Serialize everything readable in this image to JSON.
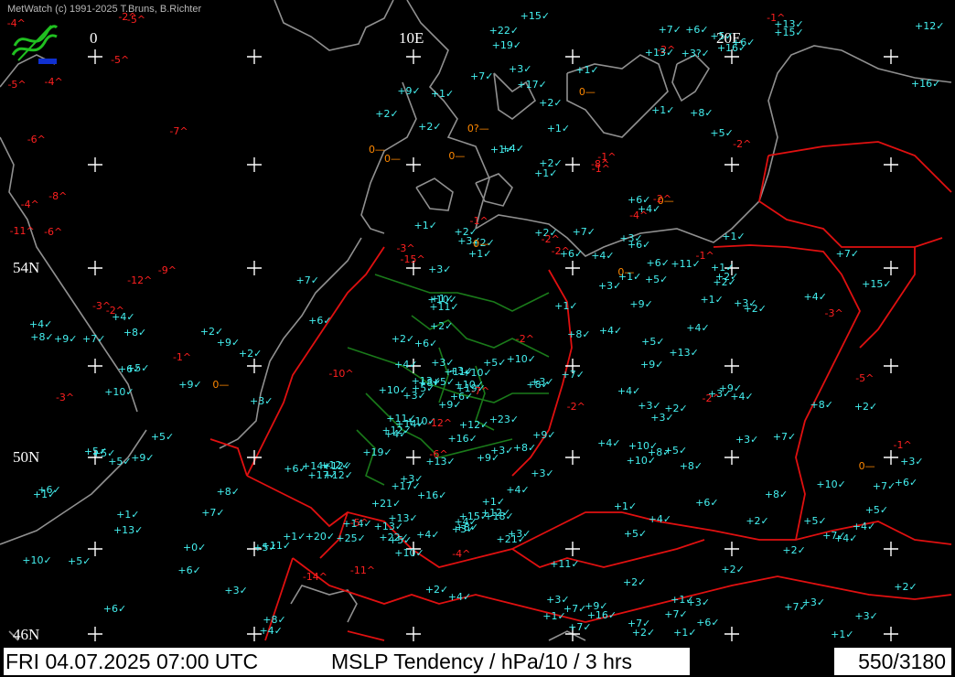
{
  "copyright": "MetWatch (c) 1991-2025 T.Bruns, B.Richter",
  "footer": {
    "datetime": "FRI 04.07.2025 07:00 UTC",
    "product": "MSLP Tendency / hPa/10 / 3 hrs",
    "frame": "550/3180"
  },
  "grid_labels": [
    "0",
    "10E",
    "20E",
    "54N",
    "50N",
    "46N"
  ],
  "colors": {
    "rising": "#44f0f0",
    "falling": "#ff2020",
    "neutral": "#ff8800",
    "coast": "#909090",
    "border": "#e01010",
    "german_states": "#1a7a1a",
    "grid": "#ffffff"
  },
  "stations": [
    [
      "+3?",
      "c"
    ],
    [
      "+22",
      "c"
    ],
    [
      "-2",
      "r"
    ],
    [
      "+7",
      "c"
    ],
    [
      "+6",
      "c"
    ],
    [
      "+1",
      "c"
    ],
    [
      "-1",
      "r"
    ],
    [
      "+6",
      "c"
    ],
    [
      "+13",
      "c"
    ],
    [
      "+16",
      "c"
    ],
    [
      "+15",
      "c"
    ],
    [
      "+16",
      "c"
    ],
    [
      "+19",
      "c"
    ],
    [
      "+12",
      "c"
    ],
    [
      "+13",
      "c"
    ],
    [
      "+15",
      "c"
    ],
    [
      "+17",
      "c"
    ],
    [
      "+7",
      "c"
    ],
    [
      "+5",
      "c"
    ],
    [
      "+3",
      "c"
    ],
    [
      "+4",
      "c"
    ],
    [
      "-3",
      "r"
    ],
    [
      "+3",
      "c"
    ],
    [
      "+1",
      "c"
    ],
    [
      "-1",
      "r"
    ],
    [
      "0",
      "o"
    ],
    [
      "+2",
      "c"
    ],
    [
      "+2",
      "c"
    ],
    [
      "0",
      "o"
    ],
    [
      "+6",
      "c"
    ],
    [
      "-2",
      "r"
    ],
    [
      "+1",
      "c"
    ],
    [
      "+2",
      "c"
    ],
    [
      "+2",
      "c"
    ],
    [
      "0?",
      "o"
    ],
    [
      "+1",
      "c"
    ],
    [
      "-1",
      "r"
    ],
    [
      "-1",
      "r"
    ],
    [
      "+1",
      "c"
    ],
    [
      "-2",
      "r"
    ],
    [
      "0",
      "o"
    ],
    [
      "+1",
      "c"
    ],
    [
      "0",
      "o"
    ],
    [
      "-4",
      "r"
    ],
    [
      "+1",
      "c"
    ],
    [
      "0",
      "o"
    ],
    [
      "-8",
      "r"
    ],
    [
      "-15",
      "r"
    ],
    [
      "-2",
      "r"
    ],
    [
      "-1",
      "r"
    ],
    [
      "+1",
      "c"
    ],
    [
      "+5",
      "c"
    ],
    [
      "+2",
      "c"
    ],
    [
      "+4",
      "c"
    ],
    [
      "+3",
      "c"
    ],
    [
      "+2",
      "c"
    ],
    [
      "+1",
      "c"
    ],
    [
      "+9",
      "c"
    ],
    [
      "+7",
      "c"
    ],
    [
      "+8",
      "c"
    ],
    [
      "+6",
      "c"
    ],
    [
      "+9",
      "c"
    ],
    [
      "+8",
      "c"
    ],
    [
      "+10",
      "c"
    ],
    [
      "+4",
      "c"
    ],
    [
      "+2",
      "c"
    ],
    [
      "+2",
      "c"
    ],
    [
      "+3",
      "c"
    ],
    [
      "+3",
      "c"
    ],
    [
      "+5",
      "c"
    ],
    [
      "+5",
      "c"
    ],
    [
      "+7",
      "c"
    ],
    [
      "+8",
      "c"
    ],
    [
      "+8",
      "c"
    ],
    [
      "+2",
      "c"
    ],
    [
      "+3",
      "c"
    ],
    [
      "+5",
      "c"
    ],
    [
      "+3",
      "c"
    ],
    [
      "+4",
      "c"
    ],
    [
      "+1",
      "c"
    ],
    [
      "+2",
      "c"
    ],
    [
      "+4",
      "c"
    ],
    [
      "+3",
      "c"
    ],
    [
      "+5",
      "c"
    ],
    [
      "+7",
      "c"
    ],
    [
      "+2",
      "c"
    ],
    [
      "+4",
      "c"
    ],
    [
      "+3",
      "c"
    ],
    [
      "+1",
      "c"
    ],
    [
      "+2",
      "c"
    ],
    [
      "0",
      "o"
    ],
    [
      "+3",
      "c"
    ],
    [
      "+4",
      "c"
    ],
    [
      "+2",
      "c"
    ],
    [
      "+3",
      "c"
    ],
    [
      "+4",
      "c"
    ],
    [
      "+5",
      "c"
    ],
    [
      "+2",
      "c"
    ],
    [
      "+3",
      "c"
    ],
    [
      "+2",
      "c"
    ],
    [
      "+3",
      "c"
    ],
    [
      "-2",
      "r"
    ],
    [
      "-1",
      "r"
    ],
    [
      "+3",
      "c"
    ],
    [
      "+1",
      "c"
    ],
    [
      "+3",
      "c"
    ],
    [
      "+3",
      "c"
    ],
    [
      "-2",
      "r"
    ],
    [
      "-3",
      "r"
    ],
    [
      "-2",
      "r"
    ],
    [
      "0",
      "o"
    ],
    [
      "+11",
      "c"
    ],
    [
      "+5",
      "c"
    ],
    [
      "+4",
      "c"
    ],
    [
      "+6",
      "c"
    ],
    [
      "+4",
      "c"
    ],
    [
      "+10",
      "c"
    ],
    [
      "+15",
      "c"
    ],
    [
      "+4",
      "c"
    ],
    [
      "+4",
      "c"
    ],
    [
      "+3",
      "c"
    ],
    [
      "+7",
      "c"
    ],
    [
      "+13",
      "c"
    ],
    [
      "+8",
      "c"
    ],
    [
      "+7",
      "c"
    ],
    [
      "+4",
      "c"
    ],
    [
      "+3",
      "c"
    ],
    [
      "+16",
      "c"
    ],
    [
      "+8",
      "c"
    ],
    [
      "+2",
      "c"
    ],
    [
      "+8",
      "c"
    ],
    [
      "+6",
      "c"
    ],
    [
      "+3",
      "c"
    ],
    [
      "+1",
      "c"
    ],
    [
      "+7",
      "c"
    ],
    [
      "+5",
      "c"
    ],
    [
      "+3",
      "c"
    ],
    [
      "+4",
      "c"
    ],
    [
      "+6",
      "c"
    ],
    [
      "+7",
      "c"
    ],
    [
      "+8",
      "c"
    ],
    [
      "+6",
      "c"
    ],
    [
      "+7",
      "c"
    ],
    [
      "+5",
      "c"
    ],
    [
      "+3",
      "c"
    ],
    [
      "+1",
      "c"
    ],
    [
      "+9",
      "c"
    ],
    [
      "+7",
      "c"
    ],
    [
      "+2",
      "c"
    ],
    [
      "+1",
      "c"
    ],
    [
      "-5",
      "r"
    ],
    [
      "-2",
      "r"
    ],
    [
      "+13",
      "c"
    ],
    [
      "+7",
      "c"
    ],
    [
      "+10",
      "c"
    ],
    [
      "+11",
      "c"
    ],
    [
      "+9",
      "c"
    ],
    [
      "+9",
      "c"
    ],
    [
      "+8",
      "c"
    ],
    [
      "+4",
      "c"
    ],
    [
      "+6",
      "c"
    ],
    [
      "+5",
      "c"
    ],
    [
      "+4",
      "c"
    ],
    [
      "+6",
      "c"
    ],
    [
      "+2",
      "c"
    ],
    [
      "+3",
      "c"
    ],
    [
      "+1",
      "c"
    ],
    [
      "+2",
      "c"
    ],
    [
      "0",
      "o"
    ],
    [
      "+1",
      "c"
    ],
    [
      "+4",
      "c"
    ],
    [
      "+3",
      "c"
    ],
    [
      "+4",
      "c"
    ],
    [
      "+1",
      "c"
    ],
    [
      "+9",
      "c"
    ],
    [
      "+1",
      "c"
    ],
    [
      "+1",
      "c"
    ],
    [
      "+2",
      "c"
    ],
    [
      "+2",
      "c"
    ],
    [
      "+3",
      "c"
    ],
    [
      "+6",
      "c"
    ],
    [
      "+8",
      "c"
    ],
    [
      "+7",
      "c"
    ],
    [
      "+5",
      "c"
    ],
    [
      "+10",
      "c"
    ],
    [
      "+10",
      "c"
    ],
    [
      "+11",
      "c"
    ],
    [
      "+9",
      "c"
    ],
    [
      "+11",
      "c"
    ],
    [
      "+10",
      "c"
    ],
    [
      "+12",
      "c"
    ],
    [
      "+13",
      "c"
    ],
    [
      "+14",
      "c"
    ],
    [
      "+12",
      "c"
    ],
    [
      "+13",
      "c"
    ],
    [
      "+10",
      "c"
    ],
    [
      "+12",
      "c"
    ],
    [
      "+11",
      "c"
    ],
    [
      "+15",
      "c"
    ],
    [
      "+14",
      "c"
    ],
    [
      "+12",
      "c"
    ],
    [
      "+10",
      "c"
    ],
    [
      "+12",
      "c"
    ],
    [
      "+14",
      "c"
    ],
    [
      "+16",
      "c"
    ],
    [
      "+17",
      "c"
    ],
    [
      "+17",
      "c"
    ],
    [
      "+20",
      "c"
    ],
    [
      "+13",
      "c"
    ],
    [
      "+19",
      "c"
    ],
    [
      "+21",
      "c"
    ],
    [
      "+23",
      "c"
    ],
    [
      "+19",
      "c"
    ],
    [
      "+18",
      "c"
    ],
    [
      "+9",
      "c"
    ],
    [
      "+22",
      "c"
    ],
    [
      "+25",
      "c"
    ],
    [
      "+16",
      "c"
    ],
    [
      "+21",
      "c"
    ],
    [
      "+12",
      "c"
    ],
    [
      "+10",
      "c"
    ],
    [
      "+10",
      "c"
    ],
    [
      "-14",
      "r"
    ],
    [
      "-12",
      "r"
    ],
    [
      "-11",
      "r"
    ],
    [
      "-5",
      "r"
    ],
    [
      "-6",
      "r"
    ],
    [
      "-7",
      "r"
    ],
    [
      "-10",
      "r"
    ],
    [
      "-4",
      "r"
    ],
    [
      "-2",
      "r"
    ],
    [
      "-5",
      "r"
    ],
    [
      "-3",
      "r"
    ],
    [
      "-4",
      "r"
    ],
    [
      "-6",
      "r"
    ],
    [
      "-5",
      "r"
    ],
    [
      "-8",
      "r"
    ],
    [
      "-4",
      "r"
    ],
    [
      "-11",
      "r"
    ],
    [
      "-12",
      "r"
    ],
    [
      "-7",
      "r"
    ],
    [
      "-9",
      "r"
    ],
    [
      "-5",
      "r"
    ],
    [
      "-6",
      "r"
    ],
    [
      "-3",
      "r"
    ],
    [
      "-2",
      "r"
    ],
    [
      "-1",
      "r"
    ],
    [
      "-4",
      "r"
    ],
    [
      "0",
      "o"
    ],
    [
      "+3",
      "c"
    ],
    [
      "+5",
      "c"
    ],
    [
      "+6",
      "c"
    ],
    [
      "+7",
      "c"
    ],
    [
      "+10",
      "c"
    ],
    [
      "+4",
      "c"
    ],
    [
      "+2",
      "c"
    ],
    [
      "+13",
      "c"
    ],
    [
      "+6",
      "c"
    ],
    [
      "+9",
      "c"
    ],
    [
      "+5",
      "c"
    ],
    [
      "+11",
      "c"
    ],
    [
      "+8",
      "c"
    ],
    [
      "+10",
      "c"
    ],
    [
      "+6",
      "c"
    ],
    [
      "+5",
      "c"
    ],
    [
      "+8",
      "c"
    ],
    [
      "+6",
      "c"
    ],
    [
      "+7",
      "c"
    ],
    [
      "+9",
      "c"
    ],
    [
      "+5",
      "c"
    ],
    [
      "+4",
      "c"
    ],
    [
      "+9",
      "c"
    ],
    [
      "+8",
      "c"
    ],
    [
      "+6",
      "c"
    ],
    [
      "+5",
      "c"
    ],
    [
      "+1",
      "c"
    ],
    [
      "+8",
      "c"
    ],
    [
      "+9",
      "c"
    ],
    [
      "+2",
      "c"
    ],
    [
      "+6",
      "c"
    ],
    [
      "+5",
      "c"
    ],
    [
      "+4",
      "c"
    ],
    [
      "+7",
      "c"
    ],
    [
      "+5",
      "c"
    ],
    [
      "+3",
      "c"
    ],
    [
      "+1",
      "c"
    ],
    [
      "+0",
      "c"
    ],
    [
      "+1",
      "c"
    ]
  ]
}
